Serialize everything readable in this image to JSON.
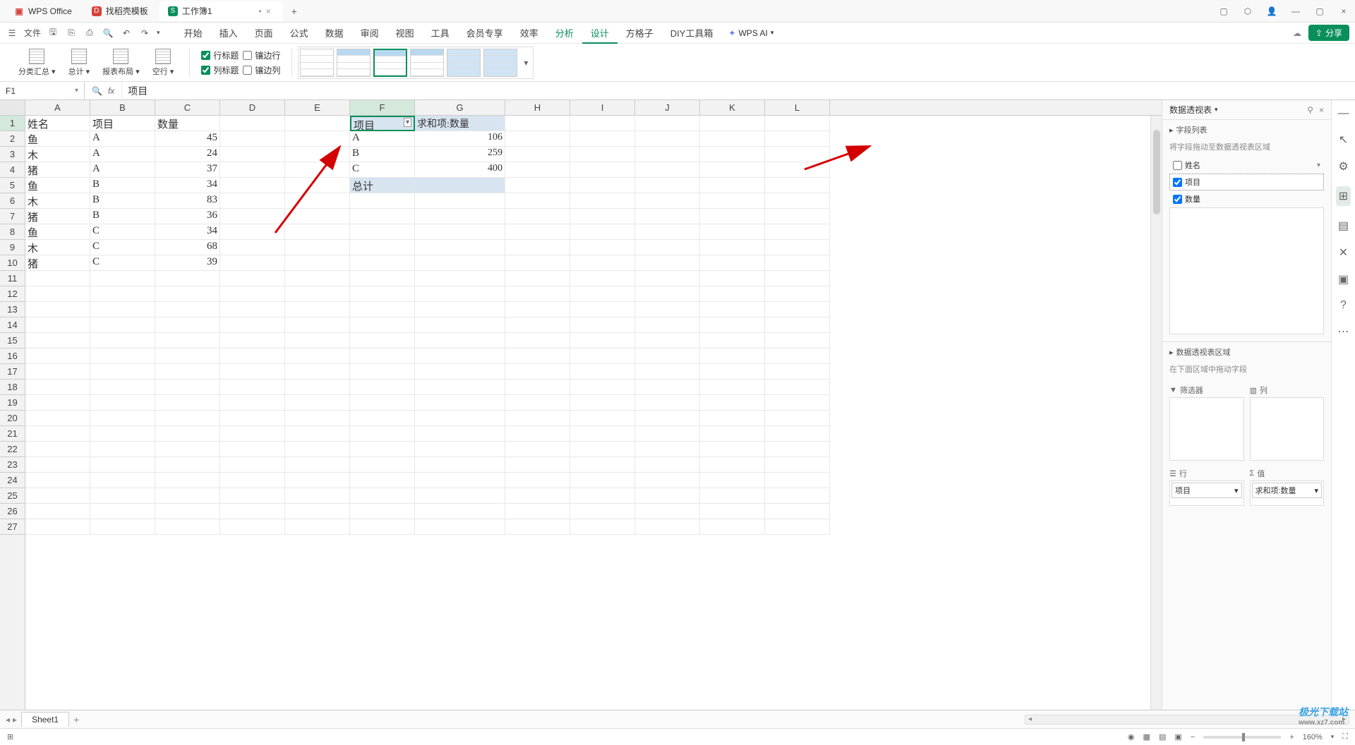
{
  "titlebar": {
    "tabs": [
      {
        "icon": "W",
        "iconColor": "#d9413c",
        "label": "WPS Office"
      },
      {
        "icon": "D",
        "iconColor": "#d9413c",
        "label": "找稻壳模板"
      },
      {
        "icon": "S",
        "iconColor": "#0a8f5b",
        "label": "工作簿1",
        "active": true,
        "dirty": "•"
      }
    ]
  },
  "menubar": {
    "file": "文件",
    "tabs": [
      "开始",
      "插入",
      "页面",
      "公式",
      "数据",
      "审阅",
      "视图",
      "工具",
      "会员专享",
      "效率",
      "分析",
      "设计",
      "方格子",
      "DIY工具箱"
    ],
    "wpsai": "WPS AI",
    "share": "分享"
  },
  "ribbon": {
    "buttons": [
      {
        "label": "分类汇总"
      },
      {
        "label": "总计"
      },
      {
        "label": "报表布局"
      },
      {
        "label": "空行"
      }
    ],
    "checks": {
      "rowHeader": "行标题",
      "bandedRow": "镶边行",
      "colHeader": "列标题",
      "bandedCol": "镶边列"
    }
  },
  "formula": {
    "nameBox": "F1",
    "fx": "fx",
    "value": "项目"
  },
  "colHeaders": [
    "A",
    "B",
    "C",
    "D",
    "E",
    "F",
    "G",
    "H",
    "I",
    "J",
    "K",
    "L"
  ],
  "rowCount": 27,
  "sourceData": {
    "headers": [
      "姓名",
      "项目",
      "数量"
    ],
    "rows": [
      [
        "鱼",
        "A",
        "45"
      ],
      [
        "木",
        "A",
        "24"
      ],
      [
        "猪",
        "A",
        "37"
      ],
      [
        "鱼",
        "B",
        "34"
      ],
      [
        "木",
        "B",
        "83"
      ],
      [
        "猪",
        "B",
        "36"
      ],
      [
        "鱼",
        "C",
        "34"
      ],
      [
        "木",
        "C",
        "68"
      ],
      [
        "猪",
        "C",
        "39"
      ]
    ]
  },
  "pivot": {
    "header1": "项目",
    "header2": "求和项:数量",
    "rows": [
      [
        "A",
        "106"
      ],
      [
        "B",
        "259"
      ],
      [
        "C",
        "400"
      ]
    ],
    "totalLabel": "总计"
  },
  "panel": {
    "title": "数据透视表",
    "fieldListTitle": "字段列表",
    "fieldListSub": "将字段拖动至数据透视表区域",
    "fields": [
      {
        "label": "姓名",
        "checked": false,
        "dd": true
      },
      {
        "label": "项目",
        "checked": true,
        "sel": true
      },
      {
        "label": "数量",
        "checked": true
      }
    ],
    "areasTitle": "数据透视表区域",
    "areasSub": "在下面区域中拖动字段",
    "areas": {
      "filter": "筛选器",
      "column": "列",
      "row": "行",
      "value": "值"
    },
    "rowChip": "项目",
    "valueChip": "求和项:数量"
  },
  "sheetTabs": {
    "sheet": "Sheet1"
  },
  "statusbar": {
    "zoom": "160%"
  },
  "watermark": {
    "brand": "极光下载站",
    "url": "www.xz7.com"
  }
}
